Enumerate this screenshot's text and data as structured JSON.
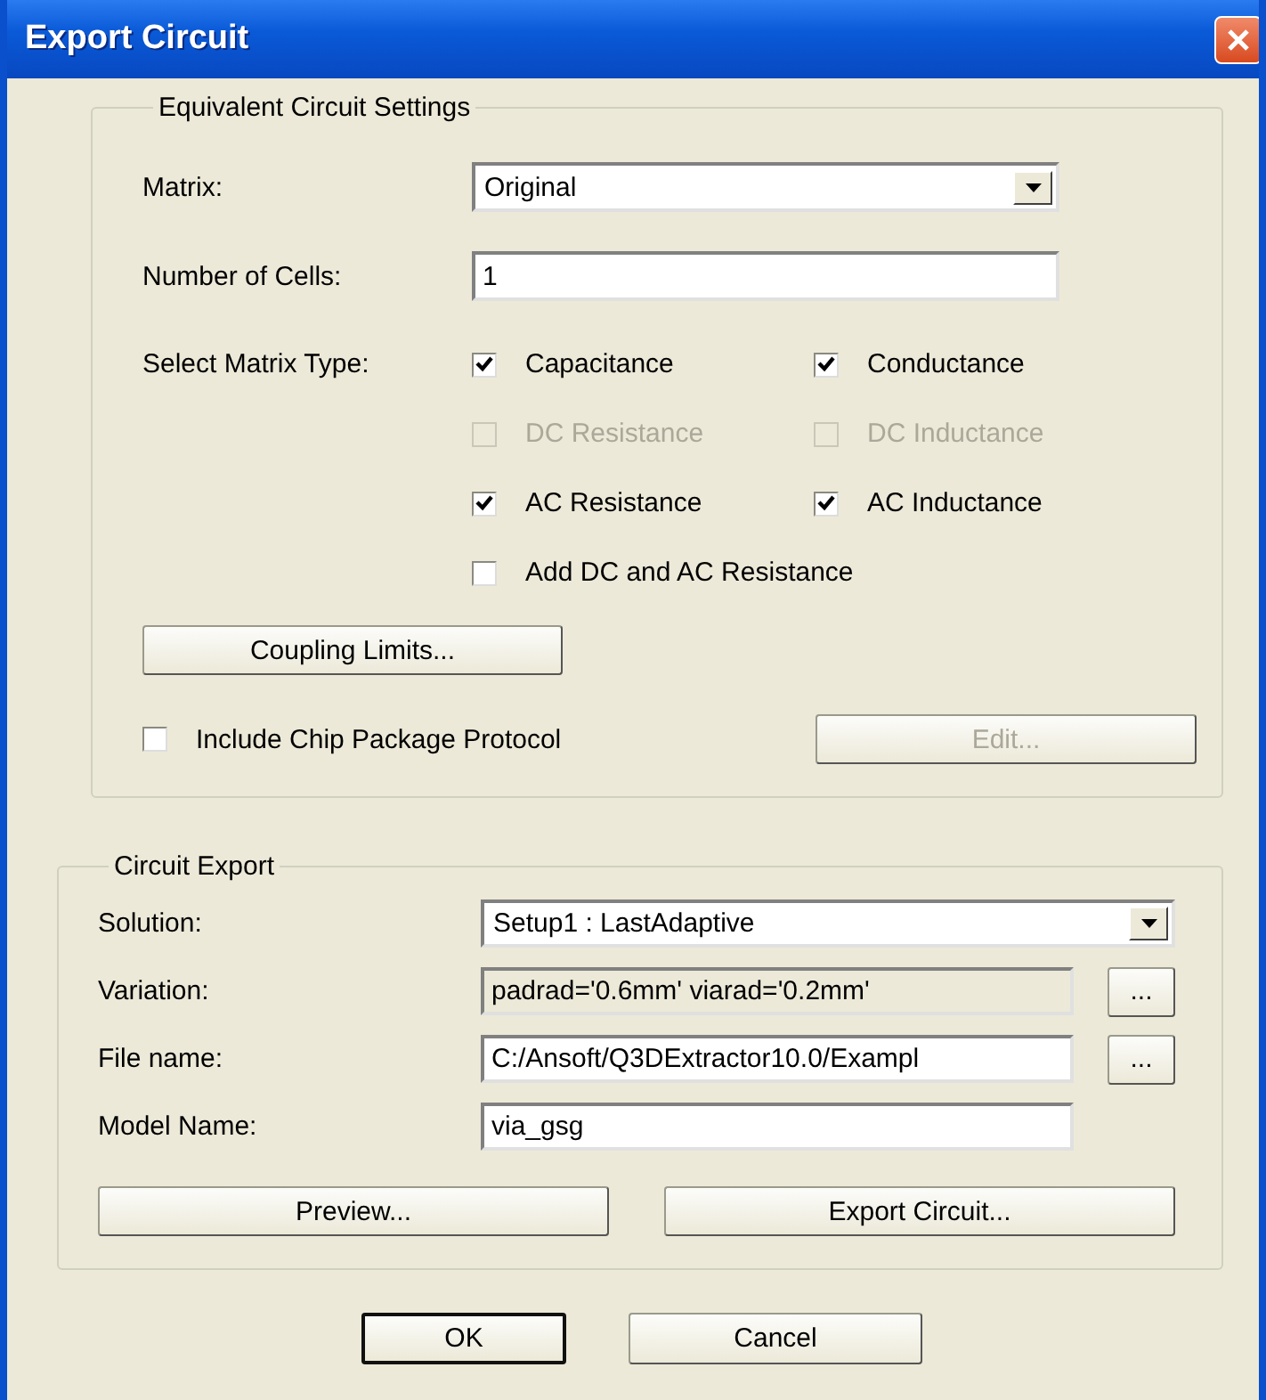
{
  "window": {
    "title": "Export Circuit"
  },
  "equivalent_circuit_settings": {
    "legend": "Equivalent Circuit Settings",
    "matrix": {
      "label": "Matrix:",
      "value": "Original"
    },
    "number_of_cells": {
      "label": "Number of Cells:",
      "value": "1"
    },
    "matrix_type": {
      "label": "Select Matrix Type:",
      "options": [
        {
          "label": "Capacitance",
          "checked": true,
          "disabled": false
        },
        {
          "label": "Conductance",
          "checked": true,
          "disabled": false
        },
        {
          "label": "DC Resistance",
          "checked": false,
          "disabled": true
        },
        {
          "label": "DC Inductance",
          "checked": false,
          "disabled": true
        },
        {
          "label": "AC Resistance",
          "checked": true,
          "disabled": false
        },
        {
          "label": "AC Inductance",
          "checked": true,
          "disabled": false
        },
        {
          "label": "Add DC and AC Resistance",
          "checked": false,
          "disabled": false
        }
      ]
    },
    "coupling_limits_button": {
      "label": "Coupling Limits...",
      "disabled": false
    },
    "include_chip_package_protocol": {
      "label": "Include Chip Package Protocol",
      "checked": false
    },
    "edit_button": {
      "label": "Edit...",
      "disabled": true
    }
  },
  "circuit_export": {
    "legend": "Circuit Export",
    "solution": {
      "label": "Solution:",
      "value": "Setup1 : LastAdaptive"
    },
    "variation": {
      "label": "Variation:",
      "value": "padrad='0.6mm' viarad='0.2mm'",
      "read_only": true,
      "browse_button": "..."
    },
    "file_name": {
      "label": "File name:",
      "value": "C:/Ansoft/Q3DExtractor10.0/Exampl",
      "read_only": false,
      "browse_button": "..."
    },
    "model_name": {
      "label": "Model Name:",
      "value": "via_gsg",
      "read_only": false
    },
    "buttons": [
      {
        "label": "Preview...",
        "disabled": false
      },
      {
        "label": "Export Circuit...",
        "disabled": false
      }
    ]
  },
  "buttons": [
    {
      "label": "OK",
      "default": true
    },
    {
      "label": "Cancel",
      "default": false
    }
  ]
}
